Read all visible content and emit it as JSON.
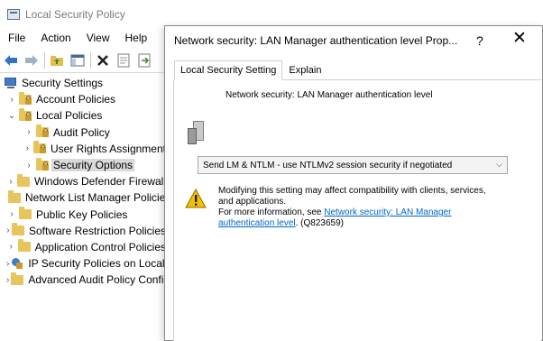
{
  "main_window": {
    "title": "Local Security Policy",
    "menu": [
      "File",
      "Action",
      "View",
      "Help"
    ],
    "toolbar_icons": [
      "back-icon",
      "forward-icon",
      "up-folder-icon",
      "show-hide-tree-icon",
      "delete-icon",
      "properties-icon",
      "export-list-icon"
    ]
  },
  "tree": [
    {
      "label": "Security Settings",
      "icon": "computer-icon",
      "level": 0,
      "expander": "none"
    },
    {
      "label": "Account Policies",
      "icon": "folder-lock-icon",
      "level": 1,
      "expander": "collapsed"
    },
    {
      "label": "Local Policies",
      "icon": "folder-lock-icon",
      "level": 1,
      "expander": "expanded"
    },
    {
      "label": "Audit Policy",
      "icon": "folder-lock-icon",
      "level": 2,
      "expander": "collapsed"
    },
    {
      "label": "User Rights Assignment",
      "icon": "folder-lock-icon",
      "level": 2,
      "expander": "collapsed"
    },
    {
      "label": "Security Options",
      "icon": "folder-lock-icon",
      "level": 2,
      "expander": "collapsed",
      "selected": true
    },
    {
      "label": "Windows Defender Firewall",
      "icon": "folder-icon",
      "level": 1,
      "expander": "collapsed"
    },
    {
      "label": "Network List Manager Policies",
      "icon": "folder-icon",
      "level": 1,
      "expander": "none"
    },
    {
      "label": "Public Key Policies",
      "icon": "folder-icon",
      "level": 1,
      "expander": "collapsed"
    },
    {
      "label": "Software Restriction Policies",
      "icon": "folder-icon",
      "level": 1,
      "expander": "collapsed"
    },
    {
      "label": "Application Control Policies",
      "icon": "folder-icon",
      "level": 1,
      "expander": "collapsed"
    },
    {
      "label": "IP Security Policies on Local Computer",
      "icon": "ipsec-icon",
      "level": 1,
      "expander": "collapsed"
    },
    {
      "label": "Advanced Audit Policy Configuration",
      "icon": "folder-icon",
      "level": 1,
      "expander": "collapsed"
    }
  ],
  "dialog": {
    "title": "Network security: LAN Manager authentication level Prop...",
    "help_label": "?",
    "close_label": "✕",
    "tabs": [
      {
        "label": "Local Security Setting",
        "active": true
      },
      {
        "label": "Explain",
        "active": false
      }
    ],
    "setting_name": "Network security: LAN Manager authentication level",
    "selected_value": "Send LM & NTLM - use NTLMv2 session security if negotiated",
    "warning_line1": "Modifying this setting may affect compatibility with clients, services,",
    "warning_line2": "and applications.",
    "warning_line3_prefix": "For more information, see ",
    "warning_link_part1": "Network security: LAN Manager",
    "warning_link_part2": "authentication level",
    "warning_suffix": ". (Q823659)"
  }
}
